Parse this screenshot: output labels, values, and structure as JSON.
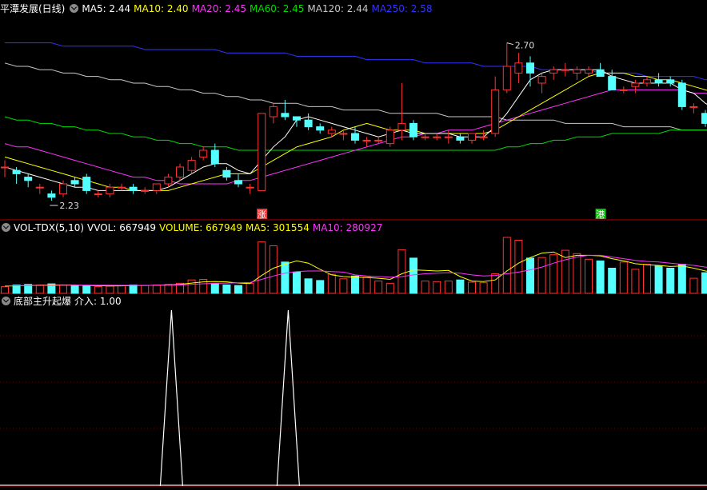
{
  "colors": {
    "up": "#ff3232",
    "down": "#54ffff",
    "ma5": "#ffffff",
    "ma10": "#ffff00",
    "ma20": "#ff33ff",
    "ma60": "#00dd00",
    "ma120": "#c8c8c8",
    "ma250": "#3232ff",
    "separator": "#b00000",
    "grid": "#660000"
  },
  "header_main": {
    "title": "平潭发展(日线)",
    "ma5": "MA5: 2.44",
    "ma10": "MA10: 2.40",
    "ma20": "MA20: 2.45",
    "ma60": "MA60: 2.45",
    "ma120": "MA120: 2.44",
    "ma250": "MA250: 2.58"
  },
  "header_vol": {
    "name": "VOL-TDX(5,10)",
    "vvol": "VVOL: 667949",
    "volume": "VOLUME: 667949",
    "ma5": "MA5: 301554",
    "ma10": "MA10: 280927"
  },
  "header_ind": {
    "name": "底部主升起爆",
    "value": "介入: 1.00"
  },
  "annotations": {
    "high": "2.70",
    "low": "2.23",
    "tag_zhang": "涨",
    "tag_gang": "港"
  },
  "chart_data": [
    {
      "type": "candlestick",
      "title": "平潭发展(日线)",
      "ylim": [
        2.18,
        2.78
      ],
      "candles": [
        {
          "o": 2.33,
          "h": 2.35,
          "l": 2.3,
          "c": 2.33
        },
        {
          "o": 2.32,
          "h": 2.33,
          "l": 2.28,
          "c": 2.31
        },
        {
          "o": 2.3,
          "h": 2.31,
          "l": 2.27,
          "c": 2.29
        },
        {
          "o": 2.27,
          "h": 2.28,
          "l": 2.25,
          "c": 2.27
        },
        {
          "o": 2.25,
          "h": 2.26,
          "l": 2.23,
          "c": 2.24
        },
        {
          "o": 2.25,
          "h": 2.29,
          "l": 2.24,
          "c": 2.28
        },
        {
          "o": 2.29,
          "h": 2.3,
          "l": 2.27,
          "c": 2.28
        },
        {
          "o": 2.3,
          "h": 2.31,
          "l": 2.25,
          "c": 2.26
        },
        {
          "o": 2.25,
          "h": 2.26,
          "l": 2.24,
          "c": 2.25
        },
        {
          "o": 2.25,
          "h": 2.28,
          "l": 2.24,
          "c": 2.27
        },
        {
          "o": 2.27,
          "h": 2.28,
          "l": 2.26,
          "c": 2.27
        },
        {
          "o": 2.27,
          "h": 2.28,
          "l": 2.25,
          "c": 2.26
        },
        {
          "o": 2.26,
          "h": 2.27,
          "l": 2.25,
          "c": 2.26
        },
        {
          "o": 2.26,
          "h": 2.28,
          "l": 2.25,
          "c": 2.28
        },
        {
          "o": 2.28,
          "h": 2.31,
          "l": 2.27,
          "c": 2.3
        },
        {
          "o": 2.3,
          "h": 2.34,
          "l": 2.29,
          "c": 2.33
        },
        {
          "o": 2.32,
          "h": 2.36,
          "l": 2.31,
          "c": 2.35
        },
        {
          "o": 2.36,
          "h": 2.39,
          "l": 2.35,
          "c": 2.38
        },
        {
          "o": 2.38,
          "h": 2.4,
          "l": 2.33,
          "c": 2.34
        },
        {
          "o": 2.32,
          "h": 2.33,
          "l": 2.29,
          "c": 2.3
        },
        {
          "o": 2.29,
          "h": 2.31,
          "l": 2.27,
          "c": 2.28
        },
        {
          "o": 2.27,
          "h": 2.28,
          "l": 2.25,
          "c": 2.27
        },
        {
          "o": 2.26,
          "h": 2.49,
          "l": 2.26,
          "c": 2.49
        },
        {
          "o": 2.48,
          "h": 2.52,
          "l": 2.46,
          "c": 2.51
        },
        {
          "o": 2.49,
          "h": 2.53,
          "l": 2.47,
          "c": 2.48
        },
        {
          "o": 2.48,
          "h": 2.48,
          "l": 2.45,
          "c": 2.47
        },
        {
          "o": 2.47,
          "h": 2.49,
          "l": 2.44,
          "c": 2.45
        },
        {
          "o": 2.45,
          "h": 2.46,
          "l": 2.43,
          "c": 2.44
        },
        {
          "o": 2.43,
          "h": 2.45,
          "l": 2.42,
          "c": 2.44
        },
        {
          "o": 2.43,
          "h": 2.44,
          "l": 2.41,
          "c": 2.43
        },
        {
          "o": 2.43,
          "h": 2.45,
          "l": 2.4,
          "c": 2.41
        },
        {
          "o": 2.41,
          "h": 2.42,
          "l": 2.39,
          "c": 2.41
        },
        {
          "o": 2.41,
          "h": 2.42,
          "l": 2.4,
          "c": 2.41
        },
        {
          "o": 2.4,
          "h": 2.45,
          "l": 2.39,
          "c": 2.44
        },
        {
          "o": 2.44,
          "h": 2.58,
          "l": 2.41,
          "c": 2.46
        },
        {
          "o": 2.46,
          "h": 2.47,
          "l": 2.41,
          "c": 2.42
        },
        {
          "o": 2.42,
          "h": 2.43,
          "l": 2.41,
          "c": 2.42
        },
        {
          "o": 2.42,
          "h": 2.43,
          "l": 2.41,
          "c": 2.42
        },
        {
          "o": 2.42,
          "h": 2.44,
          "l": 2.4,
          "c": 2.42
        },
        {
          "o": 2.42,
          "h": 2.43,
          "l": 2.4,
          "c": 2.41
        },
        {
          "o": 2.41,
          "h": 2.43,
          "l": 2.4,
          "c": 2.43
        },
        {
          "o": 2.42,
          "h": 2.44,
          "l": 2.41,
          "c": 2.42
        },
        {
          "o": 2.43,
          "h": 2.6,
          "l": 2.42,
          "c": 2.56
        },
        {
          "o": 2.56,
          "h": 2.7,
          "l": 2.55,
          "c": 2.63
        },
        {
          "o": 2.61,
          "h": 2.67,
          "l": 2.58,
          "c": 2.64
        },
        {
          "o": 2.64,
          "h": 2.66,
          "l": 2.57,
          "c": 2.61
        },
        {
          "o": 2.58,
          "h": 2.61,
          "l": 2.55,
          "c": 2.6
        },
        {
          "o": 2.61,
          "h": 2.63,
          "l": 2.59,
          "c": 2.62
        },
        {
          "o": 2.62,
          "h": 2.64,
          "l": 2.6,
          "c": 2.62
        },
        {
          "o": 2.61,
          "h": 2.63,
          "l": 2.59,
          "c": 2.62
        },
        {
          "o": 2.61,
          "h": 2.63,
          "l": 2.6,
          "c": 2.62
        },
        {
          "o": 2.62,
          "h": 2.64,
          "l": 2.6,
          "c": 2.6
        },
        {
          "o": 2.6,
          "h": 2.62,
          "l": 2.56,
          "c": 2.56
        },
        {
          "o": 2.56,
          "h": 2.57,
          "l": 2.55,
          "c": 2.56
        },
        {
          "o": 2.57,
          "h": 2.59,
          "l": 2.55,
          "c": 2.58
        },
        {
          "o": 2.58,
          "h": 2.6,
          "l": 2.57,
          "c": 2.59
        },
        {
          "o": 2.59,
          "h": 2.61,
          "l": 2.57,
          "c": 2.58
        },
        {
          "o": 2.59,
          "h": 2.6,
          "l": 2.57,
          "c": 2.58
        },
        {
          "o": 2.58,
          "h": 2.59,
          "l": 2.5,
          "c": 2.51
        },
        {
          "o": 2.51,
          "h": 2.52,
          "l": 2.49,
          "c": 2.51
        },
        {
          "o": 2.49,
          "h": 2.5,
          "l": 2.45,
          "c": 2.46
        },
        {
          "o": 2.45,
          "h": 2.46,
          "l": 2.42,
          "c": 2.44
        },
        {
          "o": 2.44,
          "h": 2.56,
          "l": 2.42,
          "c": 2.55
        },
        {
          "o": 2.58,
          "h": 2.59,
          "l": 2.43,
          "c": 2.45
        },
        {
          "o": 2.48,
          "h": 2.51,
          "l": 2.42,
          "c": 2.43
        }
      ],
      "ma5": [
        2.33,
        2.32,
        2.31,
        2.3,
        2.29,
        2.28,
        2.27,
        2.27,
        2.26,
        2.26,
        2.26,
        2.26,
        2.26,
        2.26,
        2.27,
        2.29,
        2.31,
        2.33,
        2.34,
        2.34,
        2.32,
        2.31,
        2.35,
        2.39,
        2.42,
        2.47,
        2.48,
        2.47,
        2.46,
        2.45,
        2.44,
        2.43,
        2.42,
        2.43,
        2.44,
        2.43,
        2.43,
        2.43,
        2.43,
        2.42,
        2.42,
        2.42,
        2.45,
        2.49,
        2.54,
        2.59,
        2.61,
        2.62,
        2.62,
        2.62,
        2.62,
        2.62,
        2.6,
        2.59,
        2.58,
        2.58,
        2.58,
        2.58,
        2.56,
        2.55,
        2.52,
        2.5,
        2.5,
        2.48,
        2.47
      ],
      "ma10": [
        2.36,
        2.35,
        2.34,
        2.33,
        2.32,
        2.31,
        2.3,
        2.29,
        2.28,
        2.27,
        2.27,
        2.26,
        2.26,
        2.26,
        2.26,
        2.27,
        2.28,
        2.29,
        2.3,
        2.31,
        2.31,
        2.31,
        2.33,
        2.35,
        2.37,
        2.39,
        2.4,
        2.41,
        2.42,
        2.44,
        2.45,
        2.46,
        2.45,
        2.44,
        2.44,
        2.44,
        2.43,
        2.43,
        2.43,
        2.43,
        2.43,
        2.43,
        2.44,
        2.46,
        2.48,
        2.5,
        2.52,
        2.54,
        2.56,
        2.58,
        2.6,
        2.61,
        2.61,
        2.61,
        2.6,
        2.6,
        2.59,
        2.59,
        2.58,
        2.57,
        2.56,
        2.55,
        2.54,
        2.53,
        2.52
      ],
      "ma20": [
        2.4,
        2.39,
        2.39,
        2.38,
        2.37,
        2.36,
        2.35,
        2.34,
        2.33,
        2.32,
        2.31,
        2.3,
        2.3,
        2.29,
        2.29,
        2.28,
        2.28,
        2.28,
        2.28,
        2.28,
        2.29,
        2.29,
        2.3,
        2.31,
        2.32,
        2.33,
        2.34,
        2.35,
        2.36,
        2.37,
        2.38,
        2.39,
        2.4,
        2.41,
        2.42,
        2.42,
        2.43,
        2.43,
        2.44,
        2.44,
        2.44,
        2.45,
        2.46,
        2.47,
        2.48,
        2.49,
        2.5,
        2.51,
        2.52,
        2.53,
        2.54,
        2.55,
        2.56,
        2.56,
        2.56,
        2.56,
        2.56,
        2.56,
        2.56,
        2.55,
        2.55,
        2.54,
        2.54,
        2.53,
        2.53
      ],
      "ma60": [
        2.48,
        2.47,
        2.47,
        2.46,
        2.46,
        2.45,
        2.45,
        2.44,
        2.44,
        2.43,
        2.43,
        2.42,
        2.42,
        2.41,
        2.41,
        2.4,
        2.4,
        2.39,
        2.39,
        2.39,
        2.38,
        2.38,
        2.38,
        2.38,
        2.38,
        2.38,
        2.38,
        2.38,
        2.38,
        2.38,
        2.38,
        2.38,
        2.38,
        2.38,
        2.38,
        2.38,
        2.38,
        2.38,
        2.38,
        2.38,
        2.38,
        2.38,
        2.38,
        2.39,
        2.39,
        2.4,
        2.4,
        2.41,
        2.41,
        2.42,
        2.42,
        2.42,
        2.43,
        2.43,
        2.43,
        2.43,
        2.43,
        2.44,
        2.44,
        2.44,
        2.44,
        2.44,
        2.44,
        2.45,
        2.45
      ],
      "ma120": [
        2.64,
        2.63,
        2.63,
        2.62,
        2.62,
        2.61,
        2.61,
        2.6,
        2.6,
        2.59,
        2.59,
        2.58,
        2.58,
        2.57,
        2.57,
        2.56,
        2.56,
        2.55,
        2.55,
        2.54,
        2.54,
        2.53,
        2.53,
        2.52,
        2.52,
        2.52,
        2.51,
        2.51,
        2.51,
        2.5,
        2.5,
        2.5,
        2.5,
        2.49,
        2.49,
        2.49,
        2.49,
        2.49,
        2.48,
        2.48,
        2.48,
        2.48,
        2.48,
        2.47,
        2.47,
        2.47,
        2.47,
        2.47,
        2.46,
        2.46,
        2.46,
        2.46,
        2.46,
        2.45,
        2.45,
        2.45,
        2.45,
        2.45,
        2.44,
        2.44,
        2.44,
        2.44,
        2.44,
        2.44,
        2.44
      ],
      "ma250": [
        2.7,
        2.7,
        2.7,
        2.7,
        2.7,
        2.69,
        2.69,
        2.69,
        2.69,
        2.69,
        2.69,
        2.69,
        2.68,
        2.68,
        2.68,
        2.68,
        2.68,
        2.68,
        2.68,
        2.67,
        2.67,
        2.67,
        2.67,
        2.67,
        2.67,
        2.66,
        2.66,
        2.66,
        2.66,
        2.66,
        2.66,
        2.65,
        2.65,
        2.65,
        2.65,
        2.65,
        2.64,
        2.64,
        2.64,
        2.64,
        2.64,
        2.63,
        2.63,
        2.63,
        2.63,
        2.63,
        2.62,
        2.62,
        2.62,
        2.62,
        2.62,
        2.61,
        2.61,
        2.61,
        2.61,
        2.6,
        2.6,
        2.6,
        2.6,
        2.6,
        2.59,
        2.59,
        2.59,
        2.59,
        2.58
      ]
    },
    {
      "type": "bar",
      "title": "VOL-TDX(5,10)",
      "ylim": [
        0,
        1100000
      ],
      "volume": [
        120000,
        150000,
        160000,
        150000,
        170000,
        150000,
        140000,
        130000,
        120000,
        130000,
        140000,
        150000,
        140000,
        150000,
        160000,
        180000,
        240000,
        250000,
        180000,
        150000,
        140000,
        180000,
        920000,
        850000,
        560000,
        380000,
        260000,
        230000,
        340000,
        260000,
        310000,
        290000,
        220000,
        180000,
        780000,
        630000,
        220000,
        210000,
        220000,
        240000,
        200000,
        190000,
        350000,
        1000000,
        950000,
        630000,
        640000,
        690000,
        770000,
        710000,
        610000,
        580000,
        450000,
        560000,
        430000,
        520000,
        490000,
        450000,
        520000,
        270000,
        370000,
        300000,
        460000,
        667949
      ],
      "ma5": [
        130000,
        135000,
        140000,
        145000,
        150000,
        150000,
        148000,
        142000,
        136000,
        133000,
        135000,
        140000,
        142000,
        145000,
        150000,
        160000,
        185000,
        205000,
        210000,
        205000,
        185000,
        175000,
        320000,
        450000,
        520000,
        580000,
        540000,
        430000,
        330000,
        300000,
        290000,
        285000,
        270000,
        250000,
        350000,
        420000,
        410000,
        400000,
        410000,
        300000,
        220000,
        210000,
        240000,
        400000,
        540000,
        640000,
        720000,
        740000,
        640000,
        680000,
        680000,
        670000,
        620000,
        580000,
        530000,
        510000,
        500000,
        480000,
        490000,
        450000,
        400000,
        370000,
        380000,
        400000,
        301554
      ],
      "ma10": [
        135000,
        137000,
        139000,
        141000,
        143000,
        145000,
        146000,
        146000,
        145000,
        144000,
        143000,
        143000,
        143000,
        144000,
        146000,
        150000,
        160000,
        172000,
        180000,
        185000,
        190000,
        195000,
        250000,
        310000,
        360000,
        390000,
        400000,
        400000,
        390000,
        380000,
        330000,
        310000,
        300000,
        290000,
        300000,
        330000,
        350000,
        360000,
        370000,
        360000,
        330000,
        310000,
        320000,
        350000,
        380000,
        420000,
        470000,
        540000,
        600000,
        650000,
        680000,
        680000,
        650000,
        620000,
        590000,
        570000,
        560000,
        540000,
        520000,
        500000,
        470000,
        450000,
        420000,
        400000,
        280927
      ]
    },
    {
      "type": "line",
      "title": "底部主升起爆",
      "ylim": [
        0,
        1
      ],
      "signal": [
        0,
        0,
        0,
        0,
        0,
        0,
        0,
        0,
        0,
        0,
        0,
        0,
        0,
        0,
        1,
        0,
        0,
        0,
        0,
        0,
        0,
        0,
        0,
        0,
        1,
        0,
        0,
        0,
        0,
        0,
        0,
        0,
        0,
        0,
        0,
        0,
        0,
        0,
        0,
        0,
        0,
        0,
        0,
        0,
        0,
        0,
        0,
        0,
        0,
        0,
        0,
        0,
        0,
        0,
        0,
        0,
        0,
        0,
        0,
        0,
        0,
        0,
        0,
        0,
        0
      ]
    }
  ]
}
